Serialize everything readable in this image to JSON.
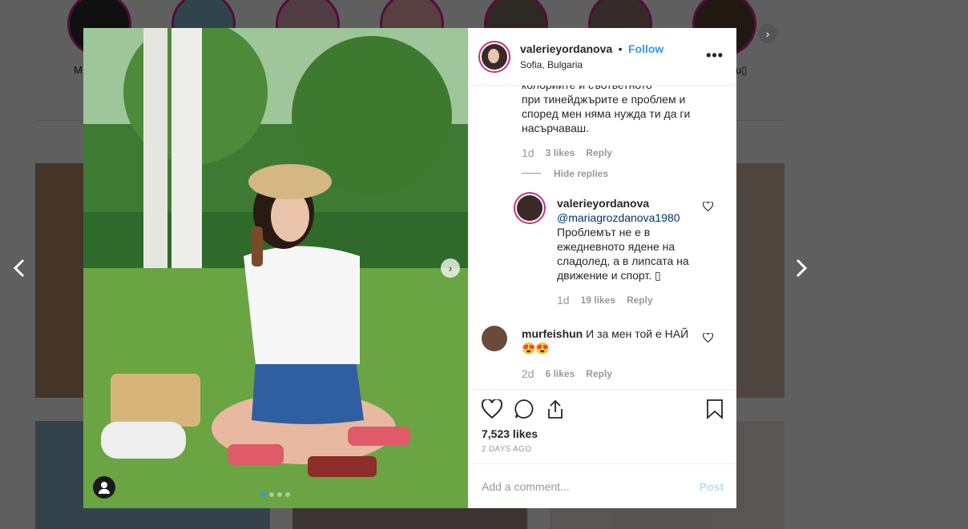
{
  "background": {
    "story_labels": [
      "M",
      "u▯"
    ],
    "icons": [
      "chevron-left-icon",
      "chevron-right-icon",
      "chevron-right-circle-icon"
    ]
  },
  "post": {
    "username": "valerieyordanova",
    "separator": "•",
    "follow_label": "Follow",
    "location": "Sofia, Bulgaria",
    "more_label": "•••",
    "carousel": {
      "active_index": 0,
      "count": 4
    }
  },
  "comments": {
    "first": {
      "partial_line": "колориите и съответното",
      "text": "при тинейджърите е проблем и според мен няма нужда ти да ги насърчаваш.",
      "time": "1d",
      "likes": "3 likes",
      "reply": "Reply"
    },
    "hide_replies": "Hide replies",
    "reply_item": {
      "username": "valerieyordanova",
      "mention": "@mariagrozdanova1980",
      "text": "Проблемът не е в ежедневното ядене на сладолед, а в липсата на движение и спорт. ▯",
      "time": "1d",
      "likes": "19 likes",
      "reply": "Reply"
    },
    "second": {
      "username": "murfeishun",
      "text": "И за мен той е НАЙ 😍😍",
      "time": "2d",
      "likes": "6 likes",
      "reply": "Reply"
    }
  },
  "footer": {
    "likes": "7,523 likes",
    "time_ago": "2 DAYS AGO",
    "comment_placeholder": "Add a comment...",
    "post_label": "Post"
  }
}
